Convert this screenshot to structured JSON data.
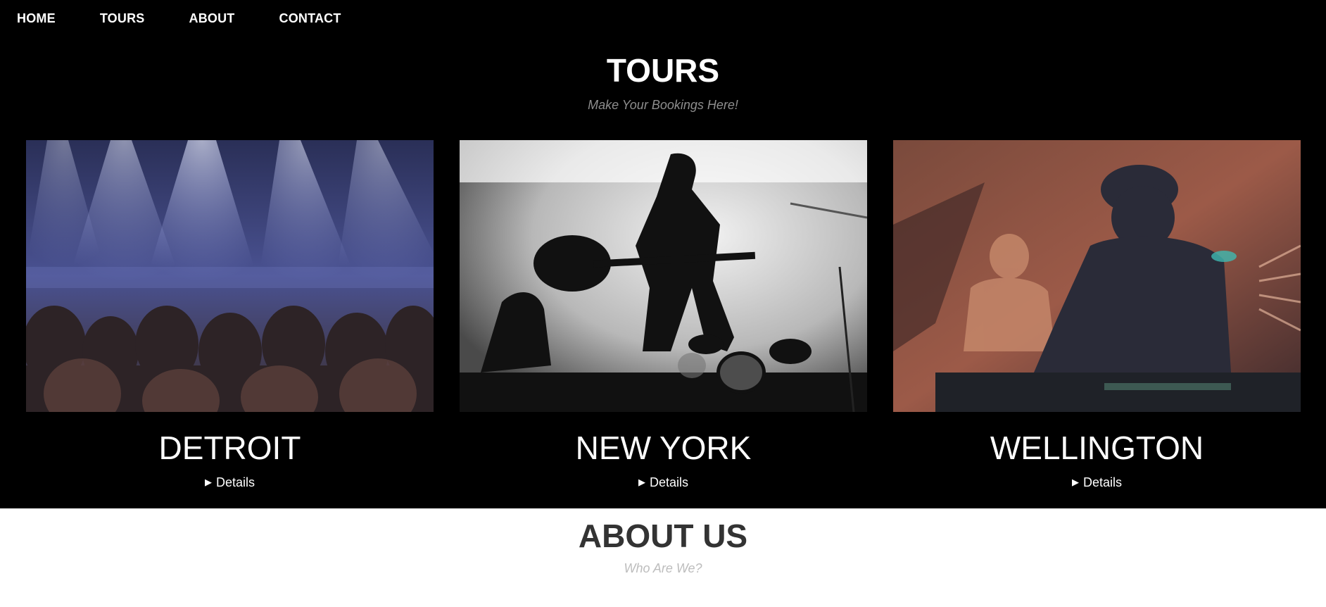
{
  "nav": {
    "items": [
      "HOME",
      "TOURS",
      "ABOUT",
      "CONTACT"
    ]
  },
  "tours": {
    "title": "TOURS",
    "subtitle": "Make Your Bookings Here!",
    "cards": [
      {
        "city": "DETROIT",
        "details_label": "Details",
        "image_desc": "concert-crowd-photo"
      },
      {
        "city": "NEW YORK",
        "details_label": "Details",
        "image_desc": "guitarist-on-stage-photo"
      },
      {
        "city": "WELLINGTON",
        "details_label": "Details",
        "image_desc": "dj-performing-photo"
      }
    ]
  },
  "about": {
    "title": "ABOUT US",
    "subtitle": "Who Are We?"
  },
  "colors": {
    "nav_bg": "#000000",
    "section_dark": "#000000",
    "subtitle_gray": "#8e8e8e",
    "about_title": "#333333",
    "about_sub": "#bdbdbd"
  }
}
